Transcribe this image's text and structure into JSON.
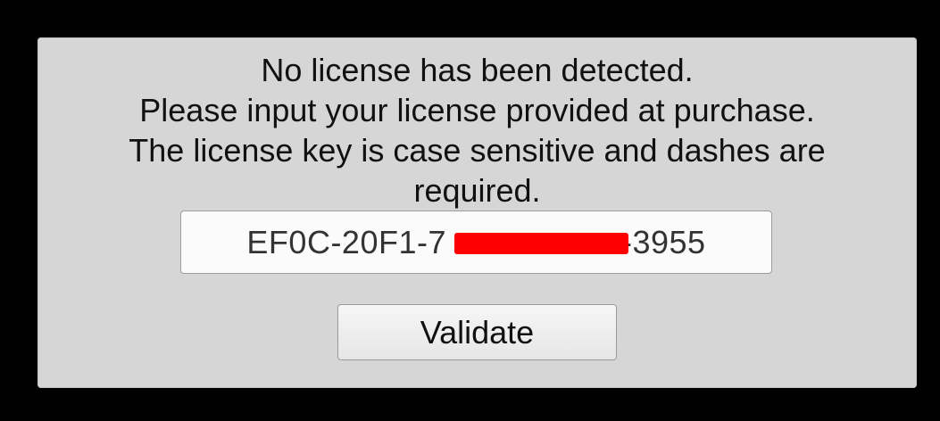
{
  "dialog": {
    "message_lines": [
      "No license has been detected.",
      "Please input your license provided at purchase.",
      "The license key is case sensitive and dashes are",
      "required."
    ],
    "license_input": {
      "value": "EF0C-20F1-7██████████-3955",
      "visible_prefix": "EF0C-20F1-7",
      "visible_suffix": "-3955",
      "redaction_color": "#ff0000"
    },
    "validate_button": {
      "label": "Validate"
    }
  }
}
